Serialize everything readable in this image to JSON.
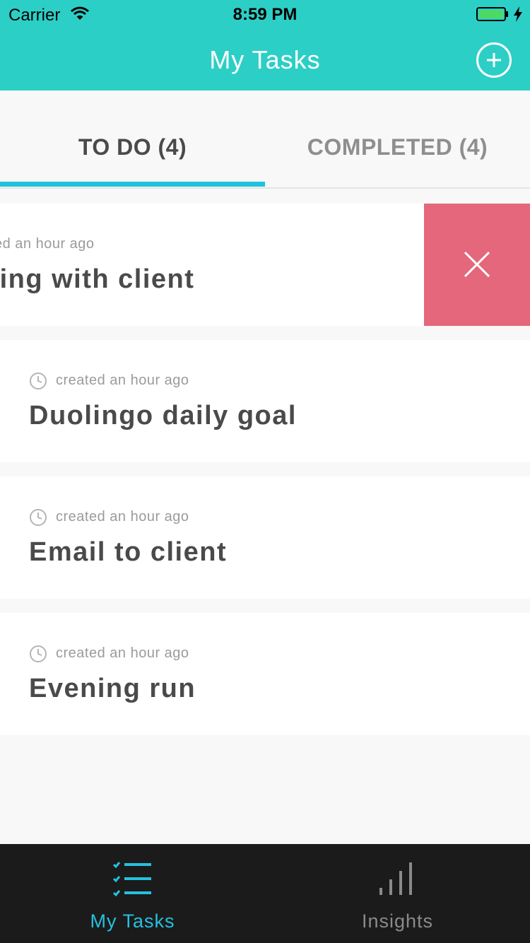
{
  "status_bar": {
    "carrier": "Carrier",
    "time": "8:59 PM"
  },
  "header": {
    "title": "My Tasks"
  },
  "tabs": [
    {
      "label": "TO DO (4)",
      "active": true
    },
    {
      "label": "COMPLETED (4)",
      "active": false
    }
  ],
  "tasks": [
    {
      "meta": "created an hour ago",
      "title": "Meeting with client",
      "swiped": true
    },
    {
      "meta": "created an hour ago",
      "title": "Duolingo daily goal"
    },
    {
      "meta": "created an hour ago",
      "title": "Email to client"
    },
    {
      "meta": "created an hour ago",
      "title": "Evening run"
    }
  ],
  "tabbar": [
    {
      "label": "My Tasks",
      "icon": "checklist-icon",
      "active": true
    },
    {
      "label": "Insights",
      "icon": "bar-chart-icon",
      "active": false
    }
  ],
  "colors": {
    "header": "#2ccfc6",
    "accent": "#1fc2dc",
    "delete": "#e5677b",
    "tabbar": "#1b1b1b"
  }
}
